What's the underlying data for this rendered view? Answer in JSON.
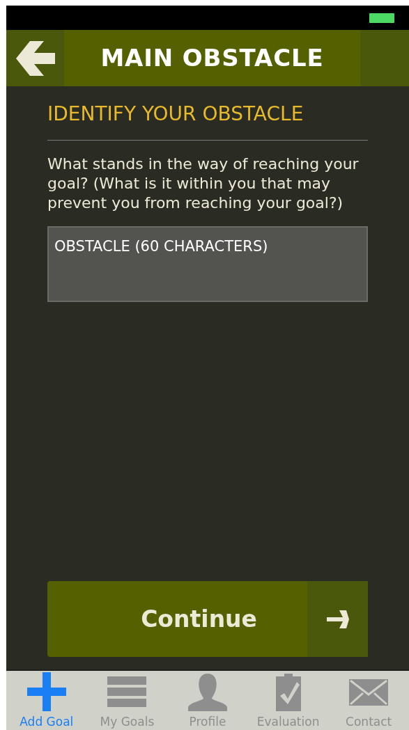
{
  "header": {
    "title": "MAIN OBSTACLE"
  },
  "section": {
    "heading": "IDENTIFY YOUR OBSTACLE",
    "question": "What stands in the way of reaching your goal? (What is it within you that may prevent you from reaching your goal?)"
  },
  "obstacle_field": {
    "placeholder": "OBSTACLE (60 CHARACTERS)"
  },
  "continue_button": {
    "label": "Continue"
  },
  "tabs": [
    {
      "kind": "plus",
      "label": "Add Goal",
      "selected": true
    },
    {
      "kind": "list",
      "label": "My Goals",
      "selected": false
    },
    {
      "kind": "person",
      "label": "Profile",
      "selected": false
    },
    {
      "kind": "clipboard",
      "label": "Evaluation",
      "selected": false
    },
    {
      "kind": "envelope",
      "label": "Contact",
      "selected": false
    }
  ]
}
